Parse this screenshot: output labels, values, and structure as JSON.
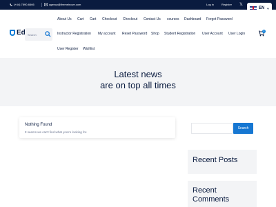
{
  "topbar": {
    "phone": "(+44) 7890-6666",
    "email": "agency@themeinove.com",
    "login": "Log in",
    "register": "Register",
    "x_icon": "x-logo-icon",
    "language": "EN"
  },
  "header": {
    "logo_text": "Ed",
    "search_placeholder": "Search",
    "nav_items": [
      "About Us",
      "Cart",
      "Cart",
      "Checkout",
      "Checkout",
      "Contact Us",
      "courses",
      "Dashboard",
      "Forgot Password",
      "Instructor Registration",
      "My account",
      "Reset Password",
      "Shop",
      "Student Registration",
      "User Account",
      "User Login",
      "User Register",
      "Wishlist"
    ],
    "cart_count": "0"
  },
  "hero": {
    "line1": "Latest news",
    "line2": "are on top all times"
  },
  "main": {
    "not_found_title": "Nothing Found",
    "not_found_text": "It seems we can't find what you're looking for."
  },
  "sidebar": {
    "search_button": "Search",
    "recent_posts_title": "Recent Posts",
    "recent_comments_line1": "Recent",
    "recent_comments_line2": "Comments"
  },
  "colors": {
    "topbar_bg": "#0a1b3f",
    "accent": "#1677d2",
    "hero_bg": "#f3f4f6"
  }
}
